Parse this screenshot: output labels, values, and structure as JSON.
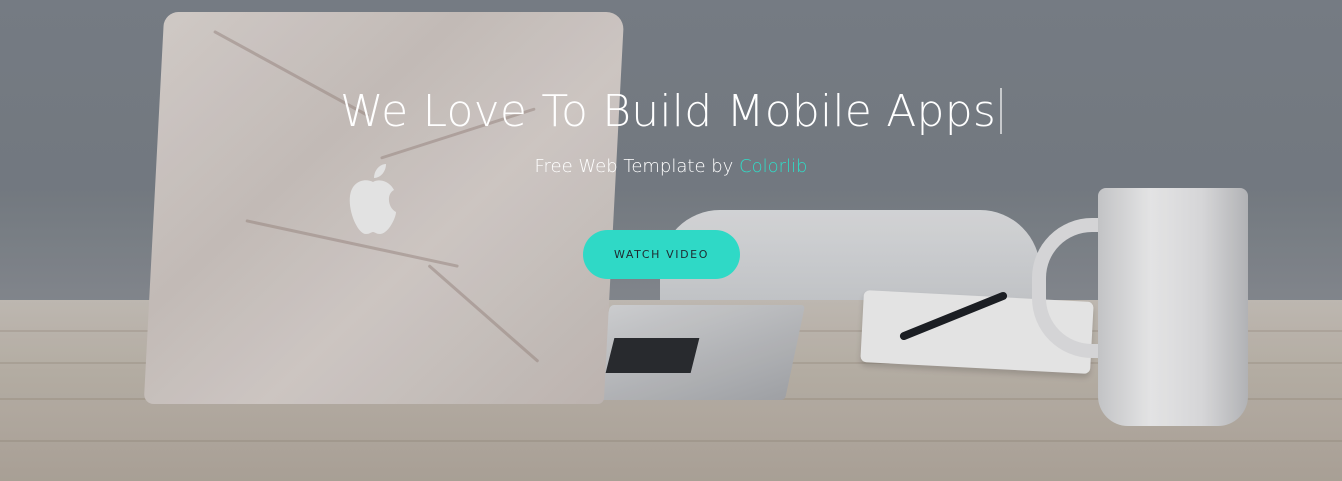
{
  "hero": {
    "title": "We Love To Build Mobile Apps",
    "subtitle_prefix": "Free Web Template by",
    "subtitle_link": "Colorlib",
    "button_label": "WATCH VIDEO"
  },
  "colors": {
    "accent": "#2fd9c6",
    "link": "#2fddc8",
    "title_text": "#ffffff"
  },
  "background_image": {
    "description_icons": [
      "laptop-image",
      "mug-image",
      "notebook-image",
      "pen-image",
      "chair-image"
    ]
  }
}
